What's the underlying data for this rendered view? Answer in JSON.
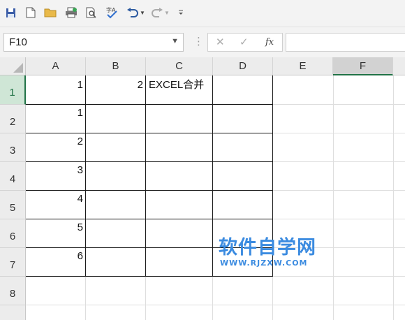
{
  "quick_access": {
    "icons": [
      "save-icon",
      "new-file-icon",
      "open-folder-icon",
      "print-icon",
      "print-preview-icon",
      "spelling-icon",
      "undo-icon",
      "redo-icon",
      "customize-icon"
    ]
  },
  "formula_bar": {
    "name_box": "F10",
    "cancel": "✕",
    "confirm": "✓",
    "fx": "fx",
    "formula": ""
  },
  "columns": [
    "A",
    "B",
    "C",
    "D",
    "E",
    "F"
  ],
  "rows": [
    "1",
    "2",
    "3",
    "4",
    "5",
    "6",
    "7",
    "8"
  ],
  "cells": {
    "A1": "1",
    "B1": "2",
    "C1": "EXCEL合并",
    "A2": "1",
    "A3": "2",
    "A4": "3",
    "A5": "4",
    "A6": "5",
    "A7": "6"
  },
  "watermark": {
    "cn": "软件自学网",
    "en": "WWW.RJZXW.COM"
  },
  "colors": {
    "accent": "#217346",
    "watermark": "#3b8be0"
  }
}
